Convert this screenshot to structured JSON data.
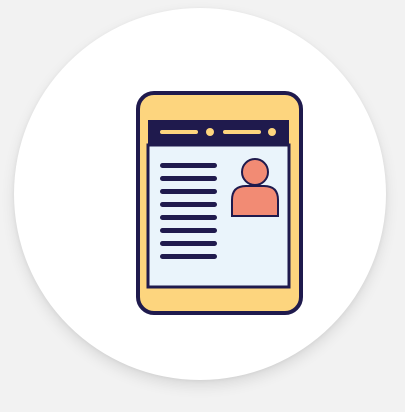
{
  "icon": {
    "name": "tablet-profile-icon",
    "colors": {
      "outline": "#1f1a4d",
      "frame": "#fdd57e",
      "screen": "#eaf4fb",
      "header_bar": "#1f1a4d",
      "header_accents": "#fdd57e",
      "text_lines": "#1f1a4d",
      "avatar": "#f28b74"
    }
  }
}
